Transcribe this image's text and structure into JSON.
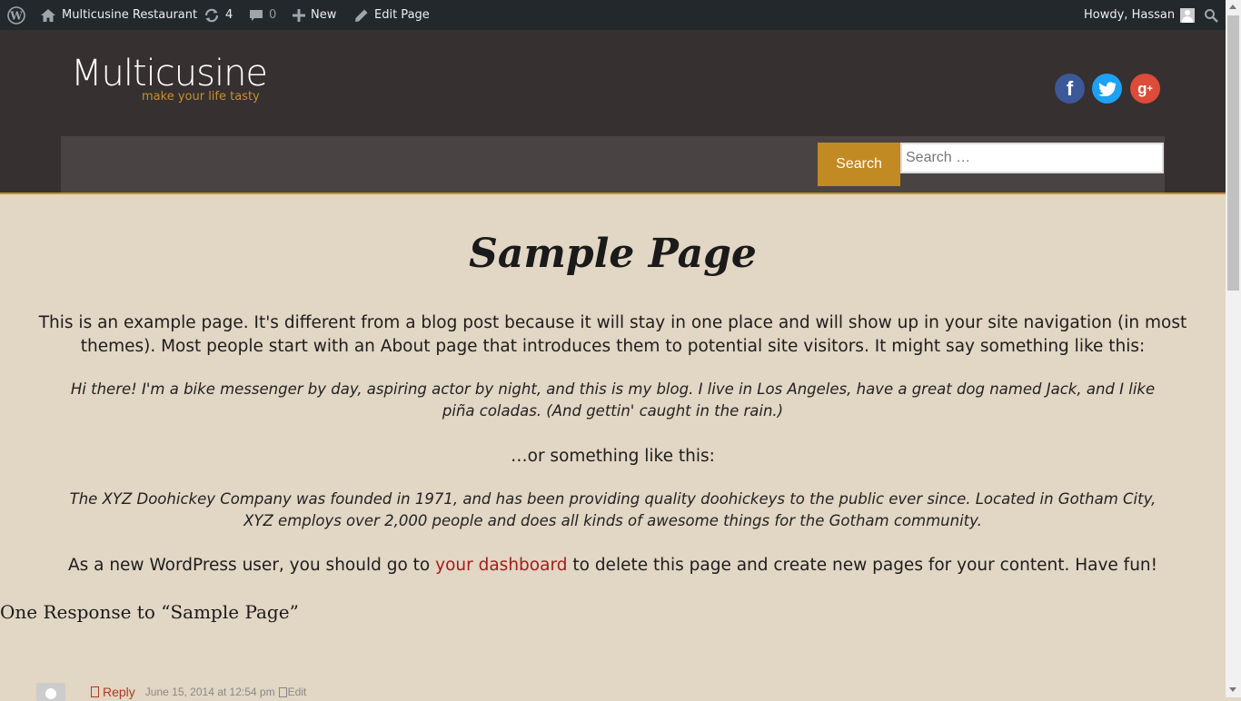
{
  "adminbar": {
    "site_name": "Multicusine Restaurant",
    "updates_count": "4",
    "comments_count": "0",
    "new_label": "New",
    "edit_label": "Edit Page",
    "howdy": "Howdy, Hassan"
  },
  "header": {
    "logo_title": "Multicusine",
    "logo_tagline": "make your life tasty",
    "social": [
      "facebook",
      "twitter",
      "google-plus"
    ],
    "search_button": "Search",
    "search_placeholder": "Search …"
  },
  "page": {
    "title": "Sample Page",
    "intro": "This is an example page. It's different from a blog post because it will stay in one place and will show up in your site navigation (in most themes). Most people start with an About page that introduces them to potential site visitors. It might say something like this:",
    "quote1": "Hi there! I'm a bike messenger by day, aspiring actor by night, and this is my blog. I live in Los Angeles, have a great dog named Jack, and I like piña coladas. (And gettin' caught in the rain.)",
    "middle": "…or something like this:",
    "quote2": "The XYZ Doohickey Company was founded in 1971, and has been providing quality doohickeys to the public ever since. Located in Gotham City, XYZ employs over 2,000 people and does all kinds of awesome things for the Gotham community.",
    "final_before": "As a new WordPress user, you should go to ",
    "final_link": "your dashboard",
    "final_after": " to delete this page and create new pages for your content. Have fun!"
  },
  "comments": {
    "heading": "One Response to “Sample Page”",
    "reply_label": "Reply",
    "date": "June 15, 2014 at 12:54 pm",
    "edit_label": "Edit"
  },
  "colors": {
    "accent": "#c28a22",
    "header_bg": "#363031",
    "page_bg": "#e2d6c4",
    "link": "#a21d1d"
  }
}
